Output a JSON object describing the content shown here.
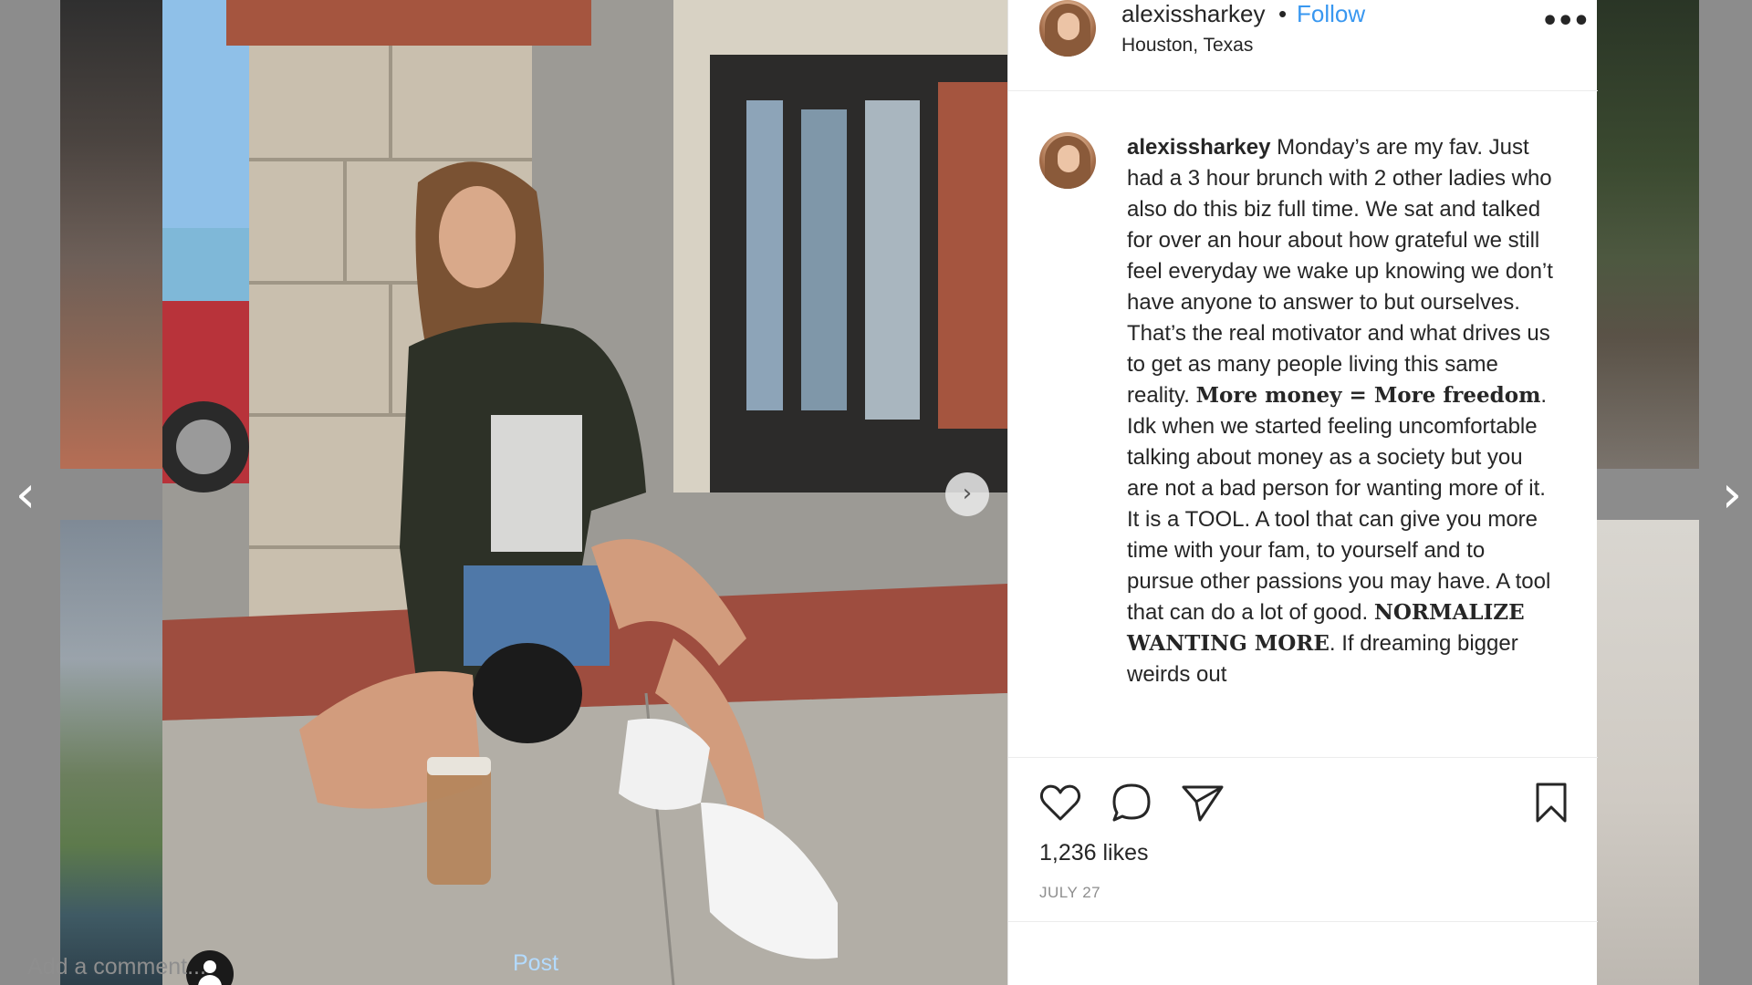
{
  "post": {
    "username": "alexissharkey",
    "separator": "•",
    "follow_label": "Follow",
    "location": "Houston, Texas",
    "more_options": "•••",
    "caption_user": "alexissharkey",
    "caption_part1": " Monday’s are my fav. Just had a 3 hour brunch with 2 other ladies who also do this biz full time. We sat and talked for over an hour about how grateful we still feel everyday we wake up knowing we don’t have anyone to answer to but ourselves. That’s the real motivator and what drives us to get as many people living this same reality. ",
    "caption_bold1": "More money = More freedom",
    "caption_part2": ". Idk when we started feeling uncomfortable talking about money as a society but you are not a bad person for wanting more of it. It is a TOOL. A tool that can give you more time with your fam, to yourself and to pursue other passions you may have. A tool that can do a lot of good. ",
    "caption_bold2": "NORMALIZE WANTING MORE",
    "caption_part3": ". If dreaming bigger weirds out",
    "likes": "1,236 likes",
    "date": "JULY 27"
  },
  "comment": {
    "placeholder": "Add a comment...",
    "post_label": "Post"
  },
  "navigation": {
    "prev_glyph": "‹",
    "next_glyph": "›",
    "photo_next_glyph": "›"
  },
  "icons": [
    "heart-icon",
    "comment-icon",
    "share-icon",
    "bookmark-icon",
    "user-tag-icon",
    "more-options-icon"
  ],
  "colors": {
    "link_blue": "#3897f0",
    "post_disabled": "#b3dbff",
    "text": "#262626",
    "muted": "#8e8e8e"
  }
}
